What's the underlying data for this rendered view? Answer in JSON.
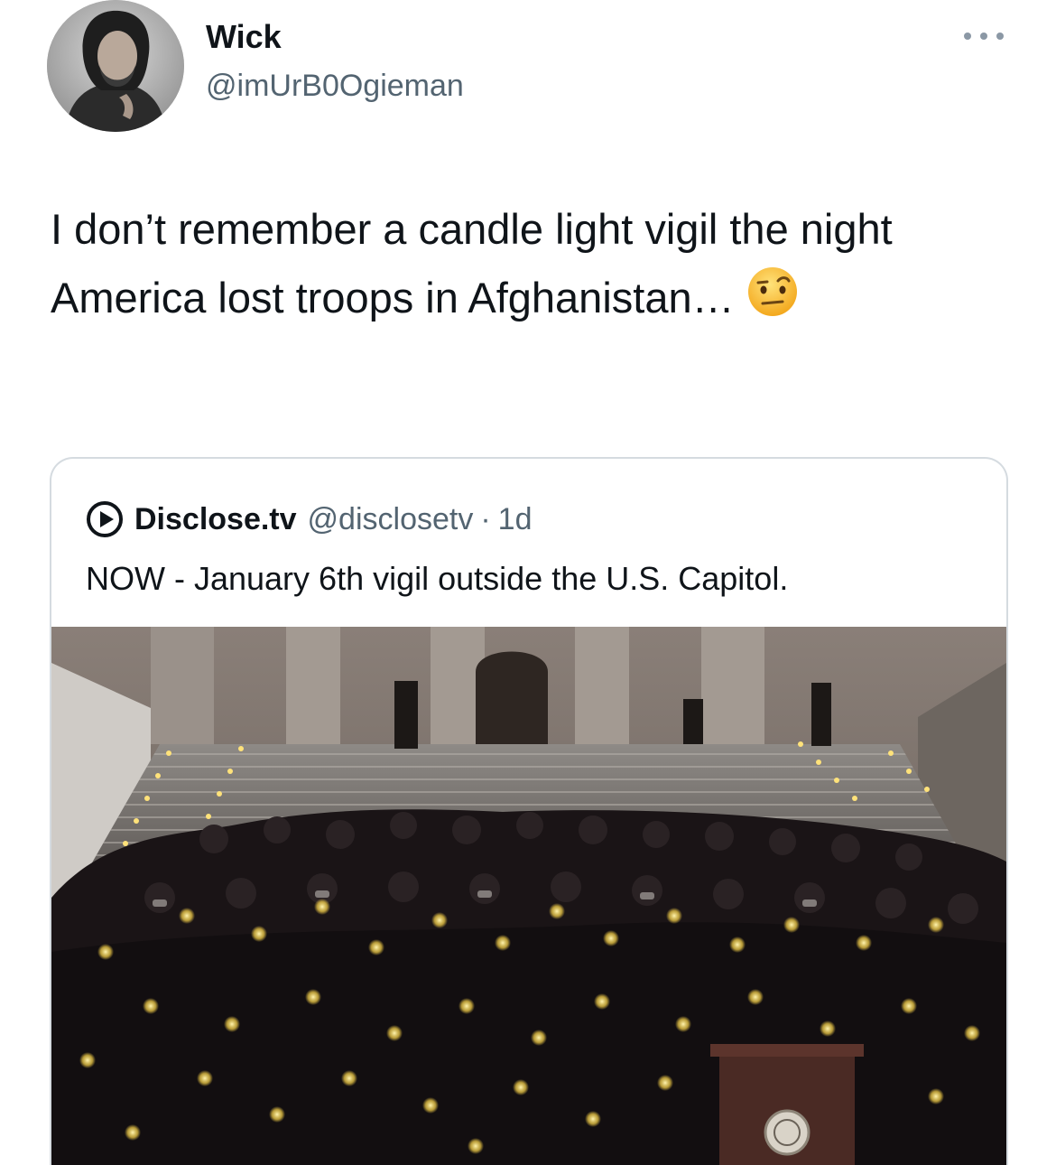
{
  "author": {
    "display_name": "Wick",
    "handle": "@imUrB0Ogieman",
    "avatar_icon": "profile-photo"
  },
  "tweet": {
    "text": "I don’t remember a candle light vigil the night America lost troops in Afghanistan…",
    "emoji": "face-with-raised-eyebrow"
  },
  "more_icon": "more-options-icon",
  "quoted_tweet": {
    "logo_icon": "play-circle-icon",
    "display_name": "Disclose.tv",
    "handle": "@disclosetv",
    "separator": "·",
    "time": "1d",
    "text": "NOW - January 6th vigil outside the U.S. Capitol.",
    "photo": "candlelight-vigil-on-capitol-steps"
  },
  "colors": {
    "text": "#0f1419",
    "secondary": "#536471",
    "border": "#d5dbe0",
    "candle": "#ffe27a"
  }
}
